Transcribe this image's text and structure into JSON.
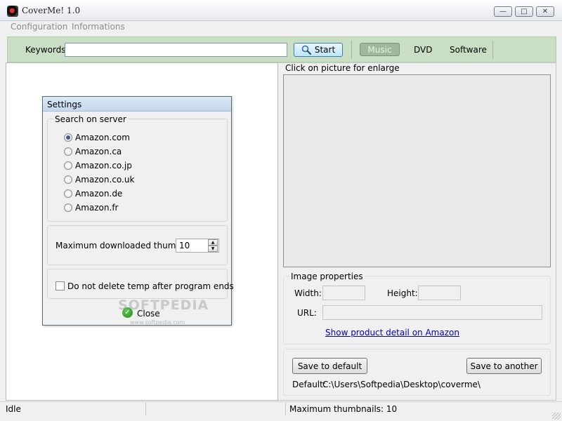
{
  "window": {
    "title": "CoverMe! 1.0",
    "minimize_glyph": "—",
    "maximize_glyph": "□",
    "close_glyph": "✕"
  },
  "menu": {
    "items": [
      "Configuration",
      "Informations"
    ]
  },
  "toolbar": {
    "keywords_label": "Keywords:",
    "keywords_value": "",
    "start_label": "Start",
    "categories": [
      "Music",
      "DVD",
      "Software"
    ],
    "active_category": "Music"
  },
  "preview": {
    "caption": "Click on picture for enlarge"
  },
  "image_properties": {
    "title": "Image properties",
    "width_label": "Width:",
    "height_label": "Height:",
    "url_label": "URL:",
    "width_value": "",
    "height_value": "",
    "url_value": "",
    "link_text": "Show product detail on Amazon"
  },
  "save": {
    "default_button": "Save to default",
    "another_button": "Save to another",
    "default_label": "Default:",
    "default_path": "C:\\Users\\Softpedia\\Desktop\\coverme\\"
  },
  "settings": {
    "title": "Settings",
    "search_group_title": "Search on server",
    "servers": [
      "Amazon.com",
      "Amazon.ca",
      "Amazon.co.jp",
      "Amazon.co.uk",
      "Amazon.de",
      "Amazon.fr"
    ],
    "selected_server": "Amazon.com",
    "max_thumbnails_label": "Maximum downloaded thumbnails",
    "max_thumbnails_value": "10",
    "keep_temp_label": "Do not delete temp after program ends",
    "keep_temp_checked": false,
    "close_label": "Close",
    "watermark": "SOFTPEDIA",
    "watermark_small": "www.softpedia.com"
  },
  "status": {
    "state": "Idle",
    "thumbnails": "Maximum thumbnails: 10"
  }
}
